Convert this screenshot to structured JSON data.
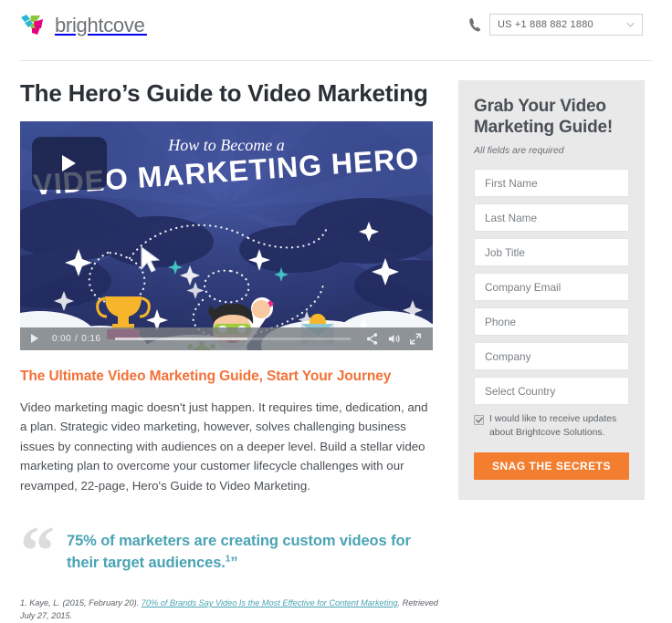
{
  "header": {
    "brand_name": "brightcove",
    "brand_trademark": "·",
    "phone_icon": "phone-icon",
    "phone_number": "US +1 888 882 1880",
    "dropdown_icon": "chevron-down-icon",
    "brand_colors": {
      "cyan": "#29b6d8",
      "green": "#8cc63f",
      "magenta": "#e6007e",
      "wordmark": "#6f7377"
    }
  },
  "main": {
    "page_title": "The Hero’s Guide to Video Marketing",
    "video": {
      "poster_title_script": "How to Become a",
      "poster_title_main": "VIDEO MARKETING HERO",
      "play_overlay_icon": "play-icon",
      "controls": {
        "play_icon": "play-icon",
        "current_time": "0:00",
        "time_separator": "/",
        "duration": "0:16",
        "share_icon": "share-icon",
        "volume_icon": "volume-icon",
        "fullscreen_icon": "fullscreen-icon"
      }
    },
    "subheading": "The Ultimate Video Marketing Guide, Start Your Journey",
    "body_paragraph": "Video marketing magic doesn't just happen. It requires time, dedication, and a plan. Strategic video marketing, however, solves challenging business issues by connecting with audiences on a deeper level. Build a stellar video marketing plan to overcome your customer lifecycle challenges with our revamped, 22-page, Hero's Guide to Video Marketing.",
    "quote": {
      "open_quote_glyph": "“",
      "text": "75% of marketers are creating custom videos for their target audiences.",
      "footnote_marker": "1",
      "close_quote_glyph": "”",
      "accent_color": "#4aa3b4"
    },
    "footnote": {
      "prefix": "1. Kaye, L. (2015, February 20). ",
      "source_link": "70% of Brands Say Video Is the Most Effective for Content Marketing",
      "suffix": ". Retrieved July 27, 2015."
    }
  },
  "form": {
    "title": "Grab Your Video Marketing Guide!",
    "required_note": "All fields are required",
    "fields": [
      {
        "name": "first-name",
        "placeholder": "First Name",
        "value": ""
      },
      {
        "name": "last-name",
        "placeholder": "Last Name",
        "value": ""
      },
      {
        "name": "job-title",
        "placeholder": "Job Title",
        "value": ""
      },
      {
        "name": "company-email",
        "placeholder": "Company Email",
        "value": ""
      },
      {
        "name": "phone",
        "placeholder": "Phone",
        "value": ""
      },
      {
        "name": "company",
        "placeholder": "Company",
        "value": ""
      },
      {
        "name": "country",
        "placeholder": "Select Country",
        "value": ""
      }
    ],
    "consent": {
      "checked": true,
      "label": "I would like to receive updates about Brightcove Solutions."
    },
    "submit_label": "SNAG THE SECRETS",
    "submit_color": "#f37e30",
    "panel_color": "#e9e9e9"
  }
}
